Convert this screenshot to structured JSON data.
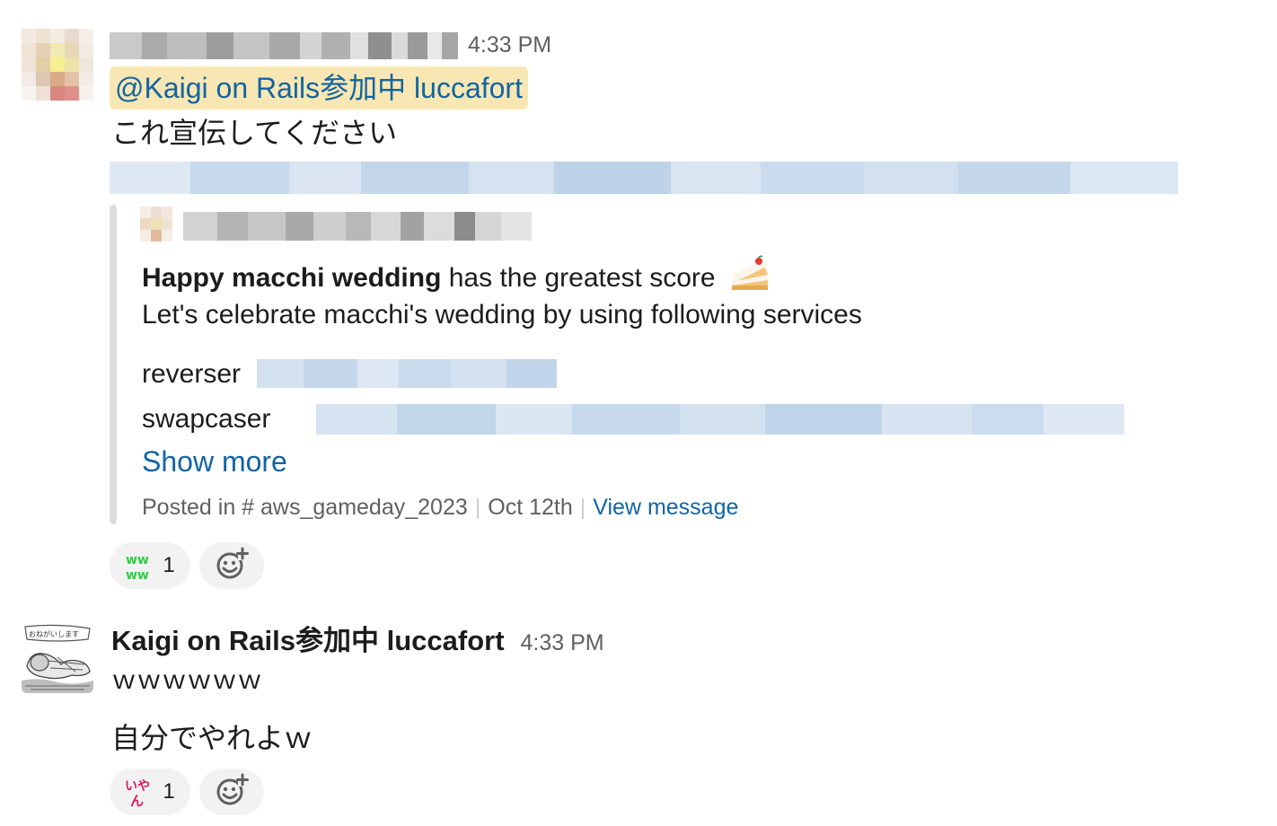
{
  "messages": [
    {
      "time": "4:33 PM",
      "mention": "@Kaigi on Rails参加中 luccafort",
      "text": "これ宣伝してください",
      "attachment": {
        "headline_bold": "Happy macchi wedding",
        "headline_rest": " has the greatest score",
        "headline_emoji": "cake-icon",
        "subline": "Let's celebrate macchi's wedding by using following services",
        "services": [
          {
            "label": "reverser"
          },
          {
            "label": "swapcaser"
          }
        ],
        "show_more": "Show more",
        "footer": {
          "posted_in": "Posted in # aws_gameday_2023",
          "date": "Oct 12th",
          "view": "View message"
        }
      },
      "reactions": [
        {
          "emoji": "ww-emoji",
          "count": "1"
        }
      ]
    },
    {
      "author": "Kaigi on Rails参加中 luccafort",
      "time": "4:33 PM",
      "lines": [
        "ｗｗｗｗｗｗ",
        "自分でやれよｗ"
      ],
      "reactions": [
        {
          "emoji": "iyan-emoji",
          "count": "1"
        }
      ]
    }
  ],
  "colors": {
    "link": "#1264a3",
    "mention_bg": "#f8e7b2",
    "muted": "#616061",
    "reaction_bg": "#f2f2f2",
    "attachment_bar": "#dddddd"
  }
}
